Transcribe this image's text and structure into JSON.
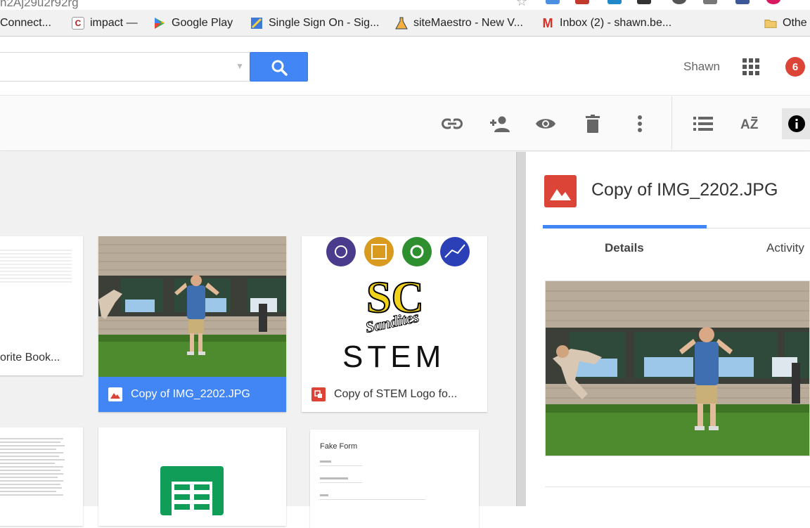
{
  "browser": {
    "url_fragment": "n2Aj29u2r92rg"
  },
  "bookmarks": [
    {
      "label": "Connect...",
      "icon": "generic-icon"
    },
    {
      "label": "impact —",
      "icon": "c-logo-icon"
    },
    {
      "label": "Google Play",
      "icon": "google-play-icon"
    },
    {
      "label": "Single Sign On - Sig...",
      "icon": "sso-icon"
    },
    {
      "label": "siteMaestro - New V...",
      "icon": "flask-icon"
    },
    {
      "label": "Inbox (2) - shawn.be...",
      "icon": "gmail-icon"
    },
    {
      "label": "Othe",
      "icon": "folder-icon"
    }
  ],
  "header": {
    "user_name": "Shawn",
    "notification_count": "6"
  },
  "toolbar": {
    "icons": [
      "link-icon",
      "share-icon",
      "preview-icon",
      "trash-icon",
      "more-icon",
      "list-view-icon",
      "sort-az-icon",
      "info-icon"
    ]
  },
  "grid": {
    "files": [
      {
        "name": "orite Book...",
        "type": "sheet"
      },
      {
        "name": "Copy of IMG_2202.JPG",
        "type": "image",
        "selected": true
      },
      {
        "name": "Copy of STEM Logo fo...",
        "type": "drawing"
      },
      {
        "name": "",
        "type": "doc"
      },
      {
        "name": "",
        "type": "sheet"
      },
      {
        "name": "",
        "type": "form"
      }
    ],
    "form_preview_title": "Fake Form",
    "logo_letters": "STEM",
    "logo_script": "Sandites"
  },
  "details": {
    "title": "Copy of IMG_2202.JPG",
    "tabs": [
      "Details",
      "Activity"
    ],
    "active_tab": "Details"
  },
  "colors": {
    "accent": "#4285f4",
    "image_red": "#db4437",
    "sheets_green": "#0f9d58"
  }
}
